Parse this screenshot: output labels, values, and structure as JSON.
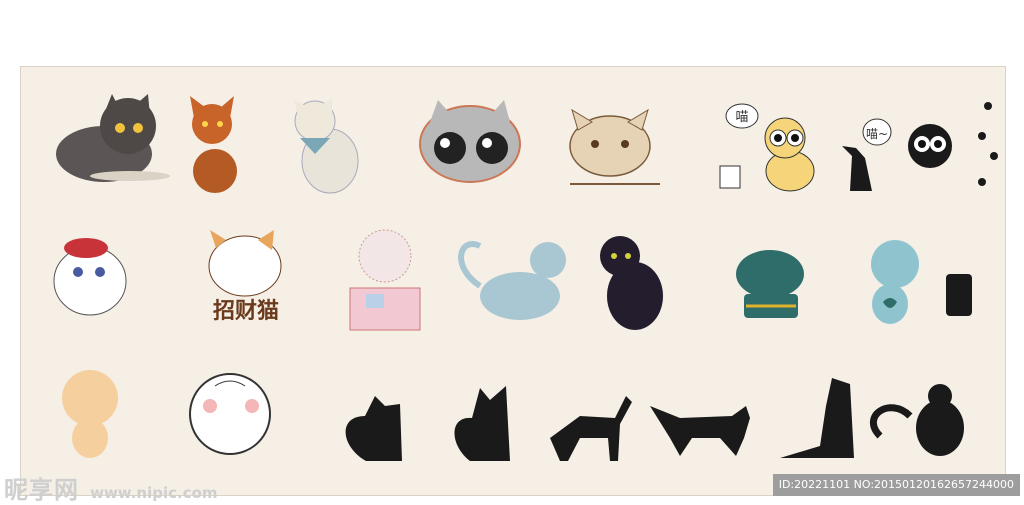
{
  "watermark": {
    "brand": "昵享网",
    "url": "www.nipic.com"
  },
  "id_badge": "ID:20221101 NO:20150120162657244000",
  "artwork": {
    "lucky_cat_caption": "招财猫",
    "meow_bubble_text": "喵",
    "meow_bubble_text_2": "喵~"
  },
  "colors": {
    "board": "#f5efe6",
    "silhouette": "#1a1a1a"
  }
}
